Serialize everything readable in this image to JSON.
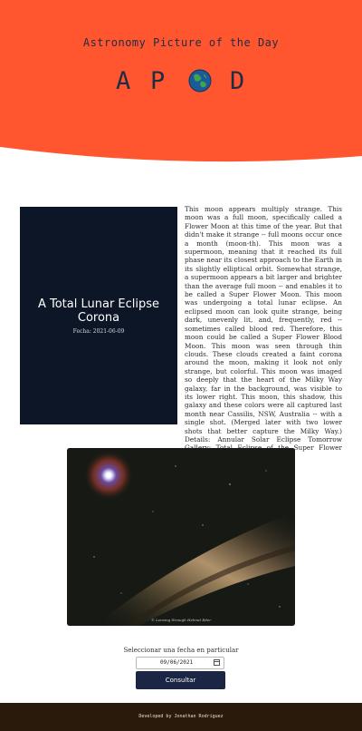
{
  "header": {
    "title": "Astronomy Picture of the Day",
    "logo_letters": [
      "A",
      "P",
      "D"
    ],
    "background_color": "#ff5630"
  },
  "apod": {
    "title": "A Total Lunar Eclipse Corona",
    "date": "Fecha: 2021-06-09",
    "explanation": "This moon appears multiply strange. This moon was a full moon, specifically called a Flower Moon at this time of the year. But that didn't make it strange -- full moons occur once a month (moon-th). This moon was a supermoon, meaning that it reached its full phase near its closest approach to the Earth in its slightly elliptical orbit. Somewhat strange, a supermoon appears a bit larger and brighter than the average full moon -- and enables it to be called a Super Flower Moon.  This moon was undergoing a total lunar eclipse. An eclipsed moon can look quite strange, being dark, unevenly lit, and, frequently, red -- sometimes called blood red. Therefore, this moon could be called a Super Flower Blood Moon. This moon was seen through thin clouds. These clouds created a faint corona around the moon, making it look not only strange, but colorful. This moon was imaged so deeply that the heart of the Milky Way galaxy, far in the background, was visible to its lower right. This moon, this shadow, this galaxy and these colors were all captured last month near Cassilis, NSW, Australia -- with a single shot. (Merged later with two lower shots that better capture the Milky Way.) Details: Annular Solar Eclipse Tomorrow Gallery: Total Eclipse of the Super Flower Blood Moon",
    "image_caption": "© Lensing through Helmut Eder"
  },
  "form": {
    "label": "Seleccionar una fecha en particular",
    "date_value": "09/06/2021",
    "submit_label": "Consultar"
  },
  "footer": {
    "text": "Developed by Jonathan Rodriguez"
  }
}
